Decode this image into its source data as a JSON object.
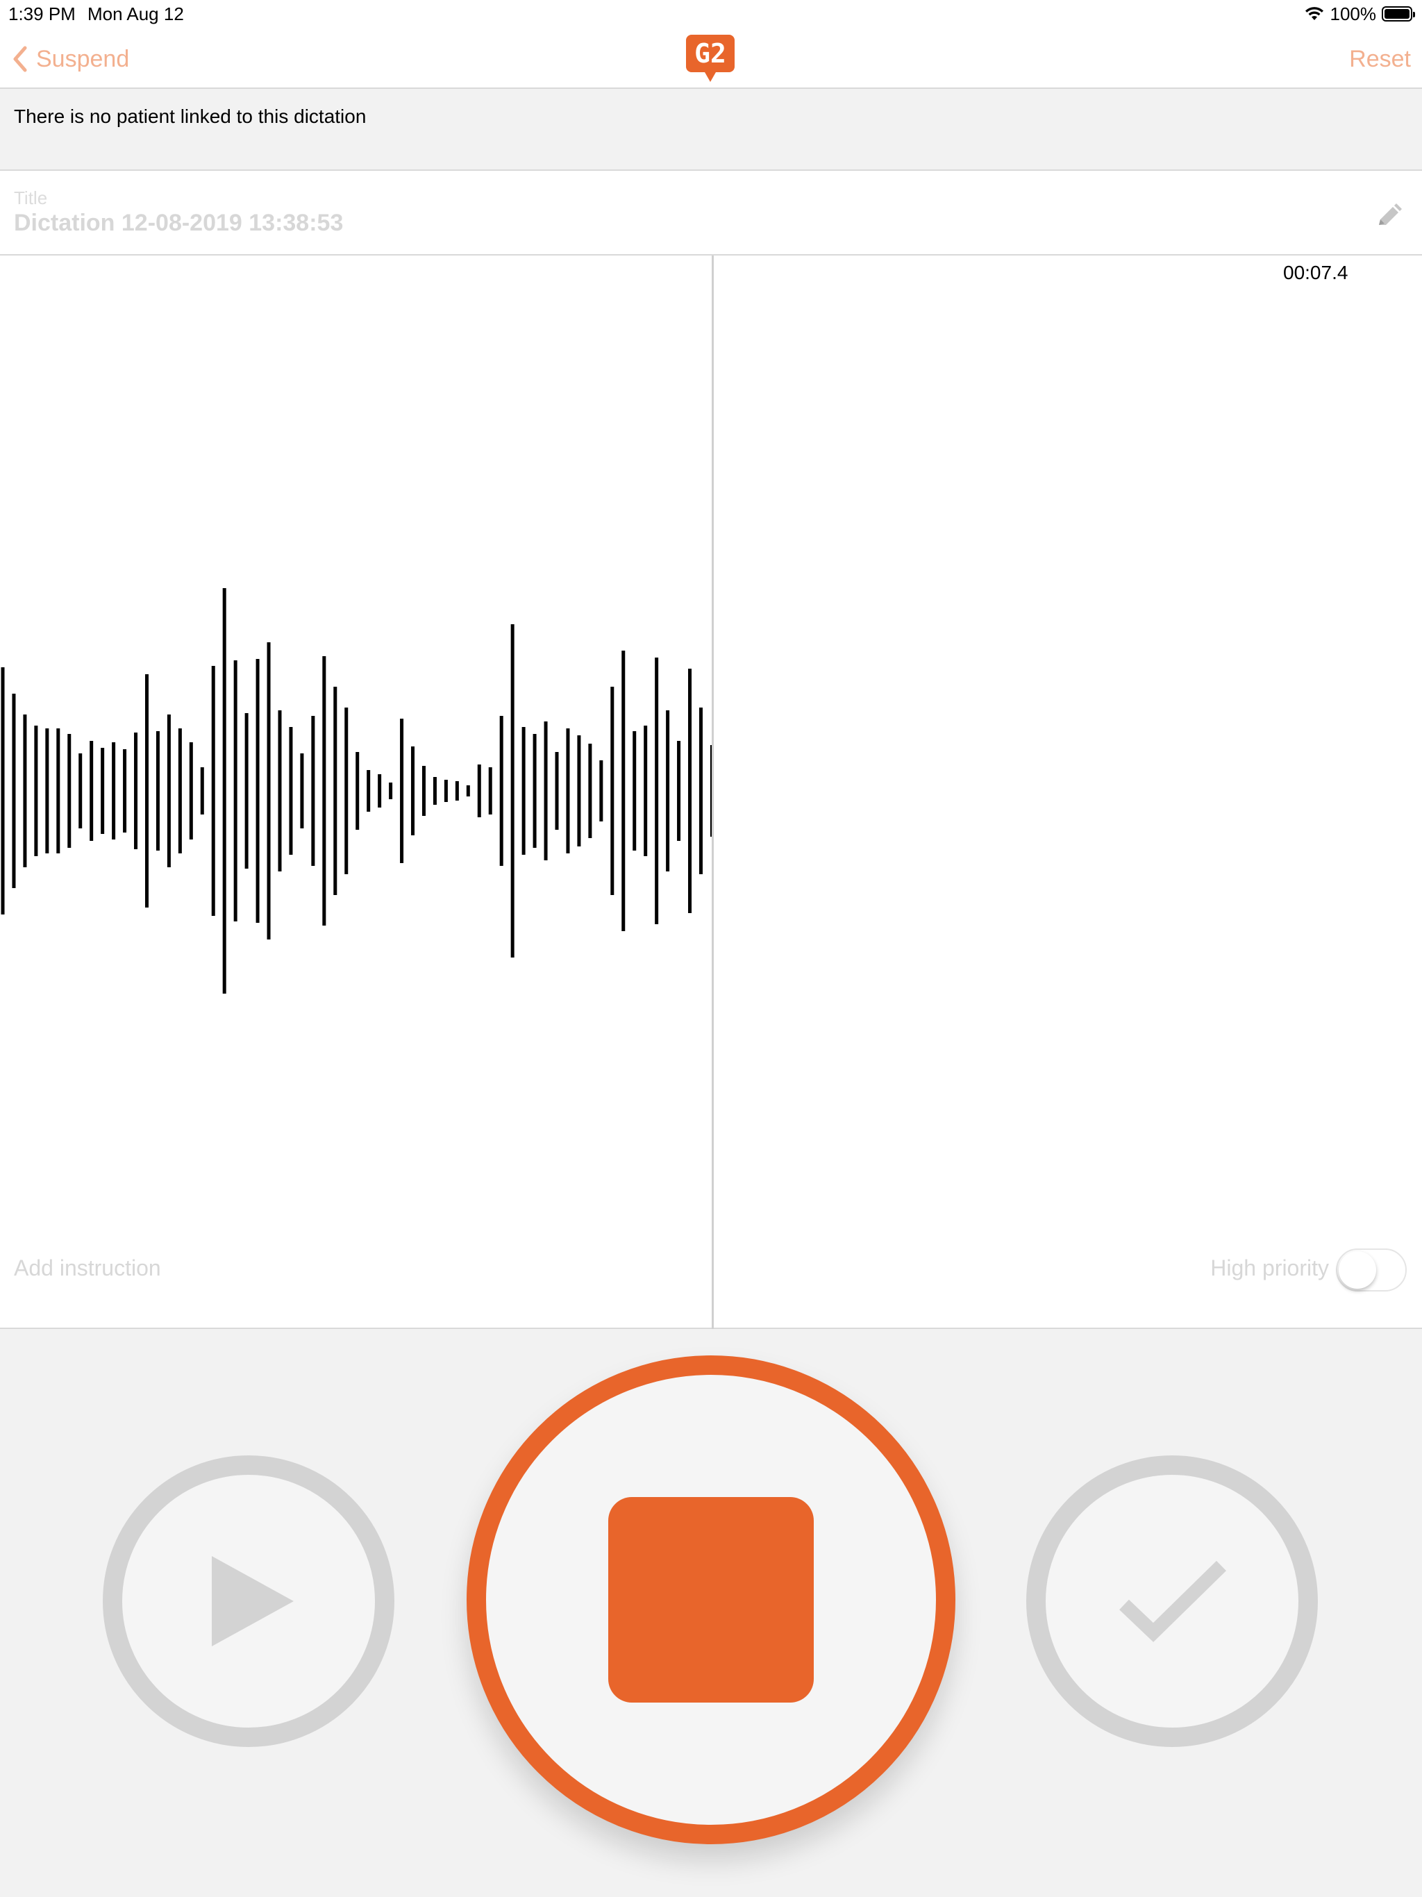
{
  "status_bar": {
    "time": "1:39 PM",
    "date": "Mon Aug 12",
    "battery": "100%"
  },
  "nav": {
    "back_label": "Suspend",
    "logo_text": "G2",
    "reset_label": "Reset"
  },
  "patient_banner": {
    "text": "There is no patient linked to this dictation"
  },
  "title_field": {
    "label": "Title",
    "value": "Dictation 12-08-2019 13:38:53"
  },
  "recording": {
    "elapsed": "00:07.4",
    "waveform_amplitudes": [
      178,
      140,
      110,
      94,
      90,
      90,
      82,
      54,
      72,
      62,
      70,
      60,
      84,
      168,
      86,
      110,
      90,
      70,
      34,
      180,
      292,
      188,
      112,
      190,
      214,
      116,
      92,
      54,
      108,
      194,
      150,
      120,
      56,
      30,
      24,
      12,
      104,
      64,
      36,
      20,
      16,
      14,
      8,
      38,
      34,
      108,
      240,
      92,
      82,
      100,
      56,
      90,
      80,
      68,
      44,
      150,
      202,
      86,
      94,
      192,
      116,
      72,
      176,
      120,
      66
    ]
  },
  "instruction": {
    "placeholder": "Add instruction"
  },
  "priority": {
    "label": "High priority",
    "enabled": false
  },
  "colors": {
    "accent": "#e8652b",
    "accent_light": "#f3b08f",
    "disabled": "#d3d3d3",
    "panel_bg": "#f2f2f2"
  },
  "controls": {
    "play_icon": "play-icon",
    "stop_icon": "stop-icon",
    "done_icon": "checkmark-icon"
  }
}
